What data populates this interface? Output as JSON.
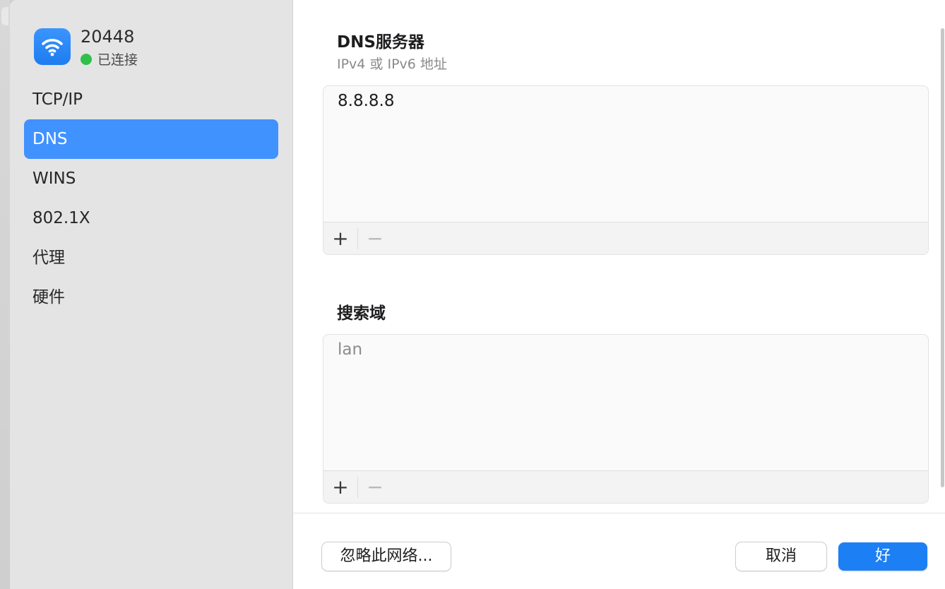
{
  "network": {
    "name": "20448",
    "status": "已连接",
    "status_color": "#2fc14b",
    "icon": "wifi-icon"
  },
  "sidebar": {
    "items": [
      {
        "label": "TCP/IP"
      },
      {
        "label": "DNS",
        "selected": true
      },
      {
        "label": "WINS"
      },
      {
        "label": "802.1X"
      },
      {
        "label": "代理"
      },
      {
        "label": "硬件"
      }
    ]
  },
  "dns": {
    "title": "DNS服务器",
    "subtitle": "IPv4 或 IPv6 地址",
    "servers": [
      "8.8.8.8"
    ],
    "add_label": "+",
    "remove_label": "−"
  },
  "search_domains": {
    "title": "搜索域",
    "domains": [
      "lan"
    ],
    "add_label": "+",
    "remove_label": "−"
  },
  "footer": {
    "forget_label": "忽略此网络...",
    "cancel_label": "取消",
    "ok_label": "好"
  },
  "colors": {
    "accent": "#1d7ff4",
    "selection": "#4092ff"
  }
}
